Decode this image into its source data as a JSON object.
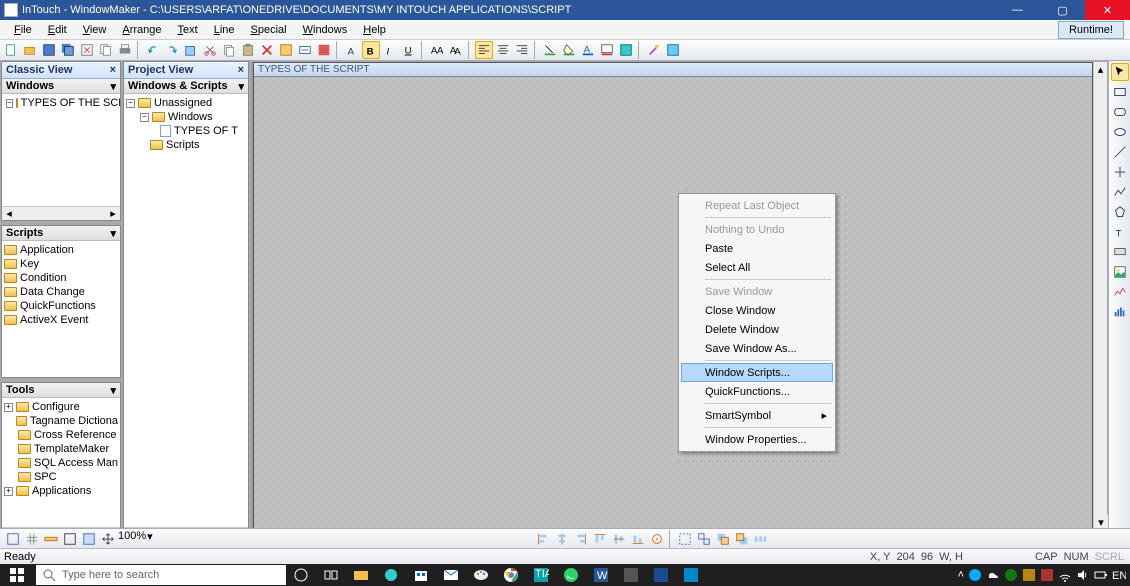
{
  "title": "InTouch - WindowMaker - C:\\USERS\\ARFAT\\ONEDRIVE\\DOCUMENTS\\MY INTOUCH APPLICATIONS\\SCRIPT",
  "menus": {
    "file": "File",
    "edit": "Edit",
    "view": "View",
    "arrange": "Arrange",
    "text": "Text",
    "line": "Line",
    "special": "Special",
    "windows": "Windows",
    "help": "Help",
    "runtime": "Runtime!"
  },
  "panels": {
    "classic": "Classic View",
    "project": "Project View",
    "windows_hdr": "Windows",
    "ws_hdr": "Windows & Scripts",
    "scripts_hdr": "Scripts",
    "tools_hdr": "Tools"
  },
  "tree_left": {
    "root": "TYPES OF THE SCR"
  },
  "tree_mid": {
    "unassigned": "Unassigned",
    "windows": "Windows",
    "types": "TYPES OF T",
    "scripts": "Scripts"
  },
  "scripts_items": [
    "Application",
    "Key",
    "Condition",
    "Data Change",
    "QuickFunctions",
    "ActiveX Event"
  ],
  "tools_items": [
    "Configure",
    "Tagname Dictiona",
    "Cross Reference",
    "TemplateMaker",
    "SQL Access Man",
    "SPC",
    "Applications"
  ],
  "canvas_title": "TYPES OF THE SCRIPT",
  "ctx": {
    "repeat": "Repeat Last Object",
    "undo": "Nothing to Undo",
    "paste": "Paste",
    "selectall": "Select All",
    "savewin": "Save Window",
    "closewin": "Close Window",
    "delwin": "Delete Window",
    "saveas": "Save Window As...",
    "winscripts": "Window Scripts...",
    "quickfn": "QuickFunctions...",
    "smartsym": "SmartSymbol",
    "props": "Window Properties..."
  },
  "zoom": "100%",
  "status": {
    "ready": "Ready",
    "xy": "X, Y",
    "x": "204",
    "y": "96",
    "wh": "W, H",
    "caps": "CAP",
    "num": "NUM",
    "scrl": "SCRL"
  },
  "search_placeholder": "Type here to search",
  "time": "",
  "date": ""
}
